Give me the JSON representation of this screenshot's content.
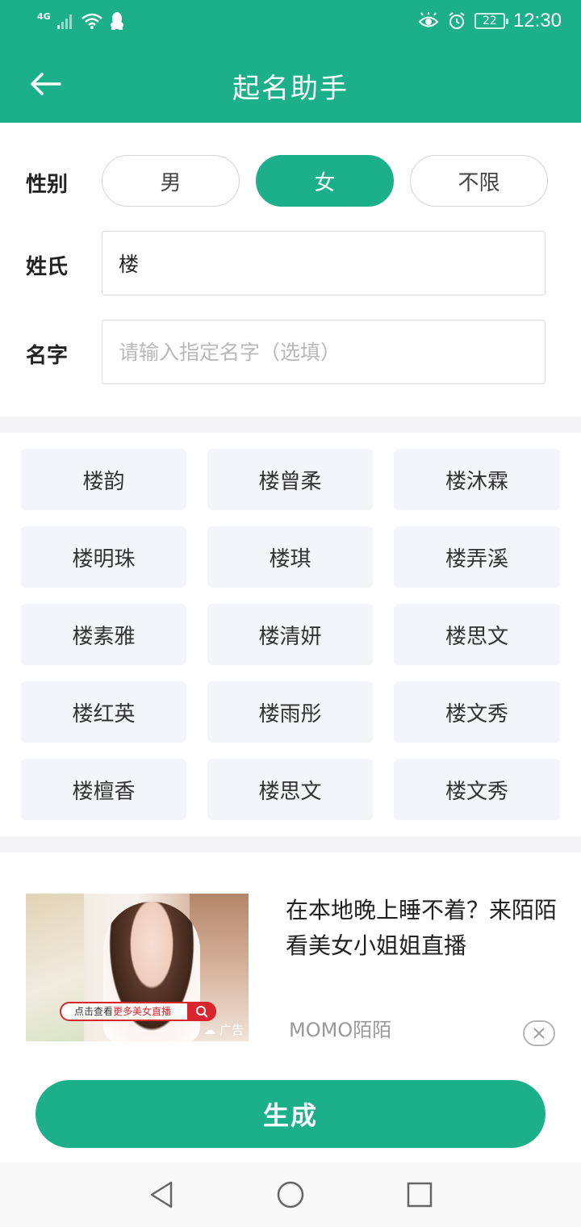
{
  "status_bar": {
    "network": "4G",
    "battery": "22",
    "time": "12:30"
  },
  "header": {
    "title": "起名助手",
    "back_icon": "arrow-left-icon"
  },
  "form": {
    "gender_label": "性别",
    "gender_options": [
      "男",
      "女",
      "不限"
    ],
    "gender_selected": "女",
    "surname_label": "姓氏",
    "surname_value": "楼",
    "given_label": "名字",
    "given_placeholder": "请输入指定名字（选填）"
  },
  "names": [
    "楼韵",
    "楼曾柔",
    "楼沐霖",
    "楼明珠",
    "楼琪",
    "楼弄溪",
    "楼素雅",
    "楼清妍",
    "楼思文",
    "楼红英",
    "楼雨彤",
    "楼文秀",
    "楼檀香",
    "楼思文",
    "楼文秀"
  ],
  "ad": {
    "image_cta_prefix": "点击查看",
    "image_cta_highlight": "更多美女直播",
    "image_badge": "广告",
    "title": "在本地晚上睡不着？来陌陌看美女小姐姐直播",
    "source": "MOMO陌陌"
  },
  "generate_button": "生成",
  "colors": {
    "primary": "#1cb08a",
    "chip_bg": "#f4f5f8",
    "ad_red": "#d9262e"
  }
}
